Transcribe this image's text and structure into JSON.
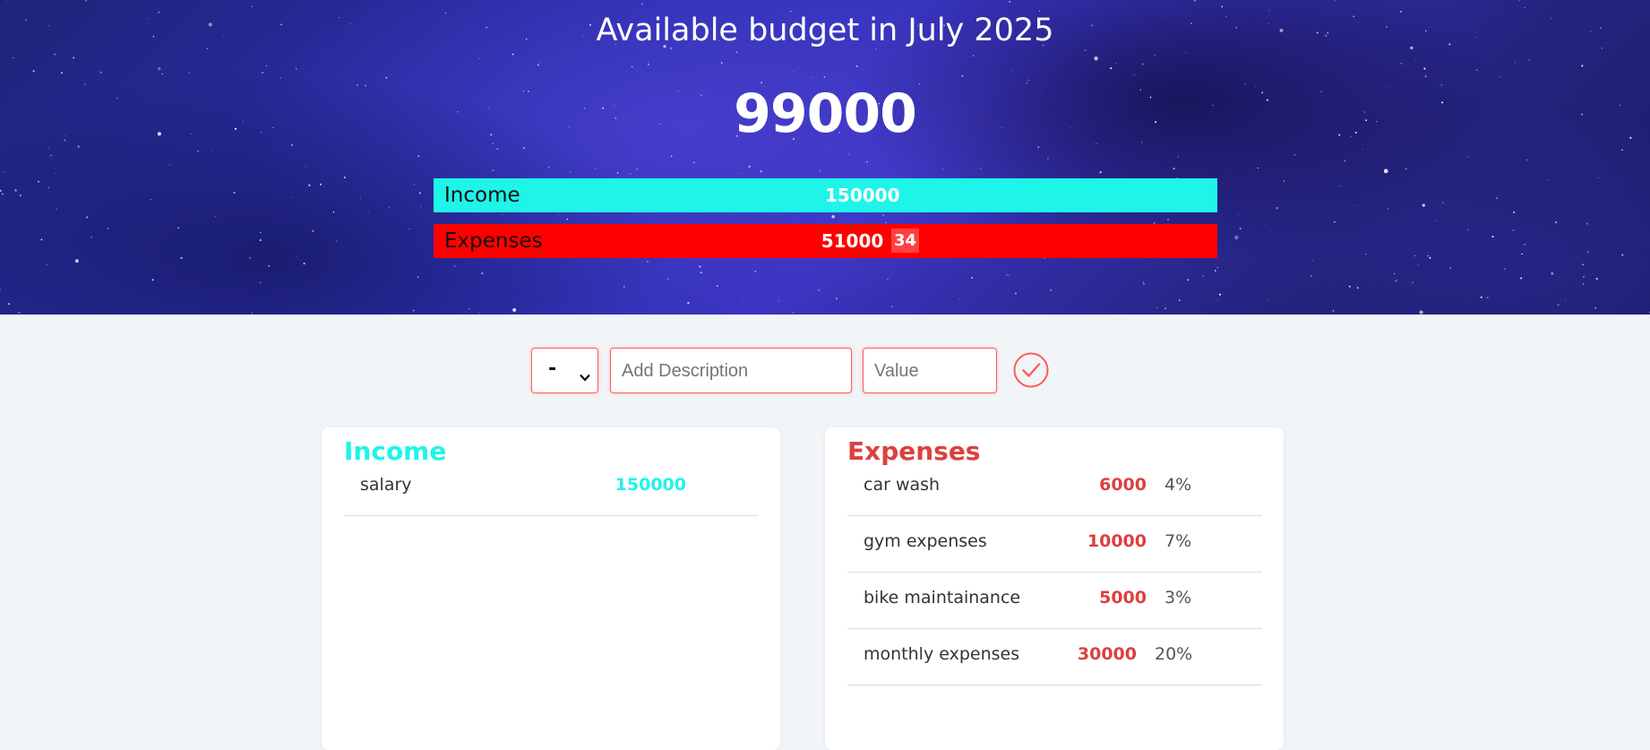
{
  "header": {
    "title": "Available budget in July 2025",
    "available_budget": "99000",
    "income_label": "Income",
    "income_total": "150000",
    "expenses_label": "Expenses",
    "expenses_total": "51000",
    "expenses_percent": "34"
  },
  "form": {
    "type_selected": "-",
    "description_placeholder": "Add Description",
    "value_placeholder": "Value"
  },
  "income": {
    "title": "Income",
    "items": [
      {
        "description": "salary",
        "value": "150000"
      }
    ]
  },
  "expenses": {
    "title": "Expenses",
    "items": [
      {
        "description": "car wash",
        "value": "6000",
        "percent": "4%"
      },
      {
        "description": "gym expenses",
        "value": "10000",
        "percent": "7%"
      },
      {
        "description": "bike maintainance",
        "value": "5000",
        "percent": "3%"
      },
      {
        "description": "monthly expenses",
        "value": "30000",
        "percent": "20%"
      }
    ]
  },
  "colors": {
    "income": "#1ff4e8",
    "expenses_bar": "#ff0000",
    "expenses_text": "#dc4040",
    "accent": "#ff5a5a"
  },
  "icons": {
    "submit": "checkmark-circle-icon",
    "select": "chevron-down-icon"
  }
}
